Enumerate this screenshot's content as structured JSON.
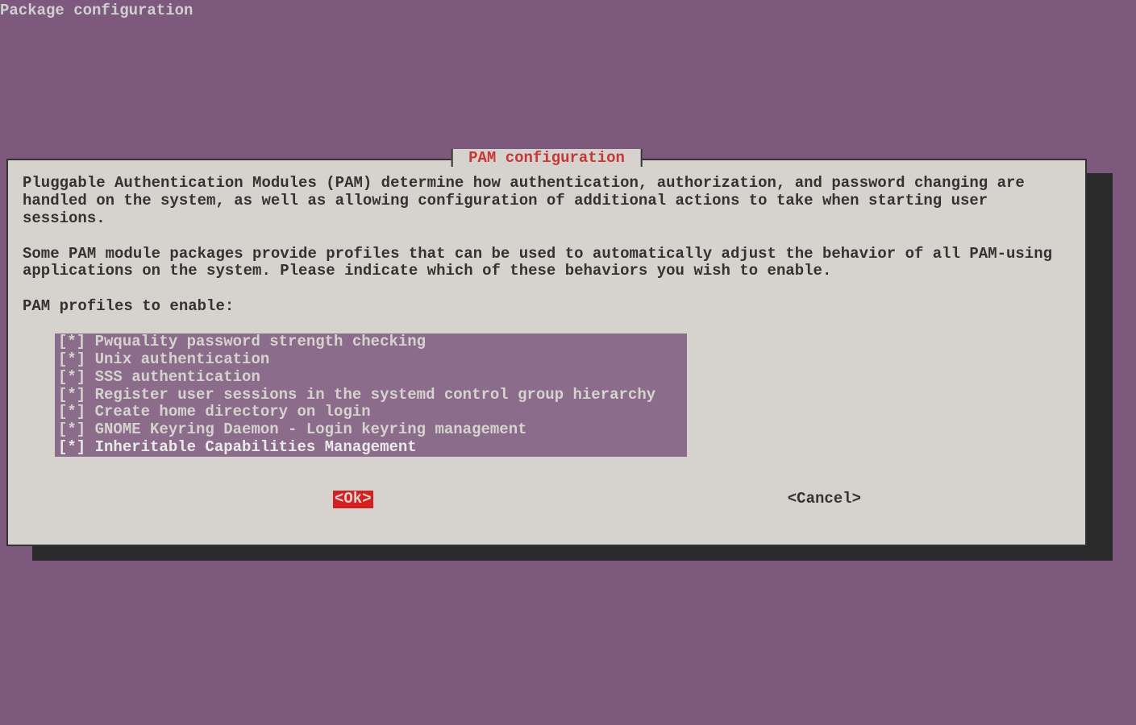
{
  "header": "Package configuration",
  "dialog": {
    "title": " PAM configuration ",
    "paragraph1": "Pluggable Authentication Modules (PAM) determine how authentication, authorization, and password changing are handled on the system, as well as allowing configuration of additional actions to take when starting user sessions.",
    "paragraph2": "Some PAM module packages provide profiles that can be used to automatically adjust the behavior of all PAM-using applications on the system.  Please indicate which of these behaviors you wish to enable.",
    "prompt": "PAM profiles to enable:",
    "options": [
      {
        "checked": true,
        "label": "Pwquality password strength checking"
      },
      {
        "checked": true,
        "label": "Unix authentication"
      },
      {
        "checked": true,
        "label": "SSS authentication"
      },
      {
        "checked": true,
        "label": "Register user sessions in the systemd control group hierarchy"
      },
      {
        "checked": true,
        "label": "Create home directory on login"
      },
      {
        "checked": true,
        "label": "GNOME Keyring Daemon - Login keyring management"
      },
      {
        "checked": true,
        "label": "Inheritable Capabilities Management"
      }
    ],
    "ok_label": "<Ok>",
    "cancel_label": "<Cancel>"
  }
}
